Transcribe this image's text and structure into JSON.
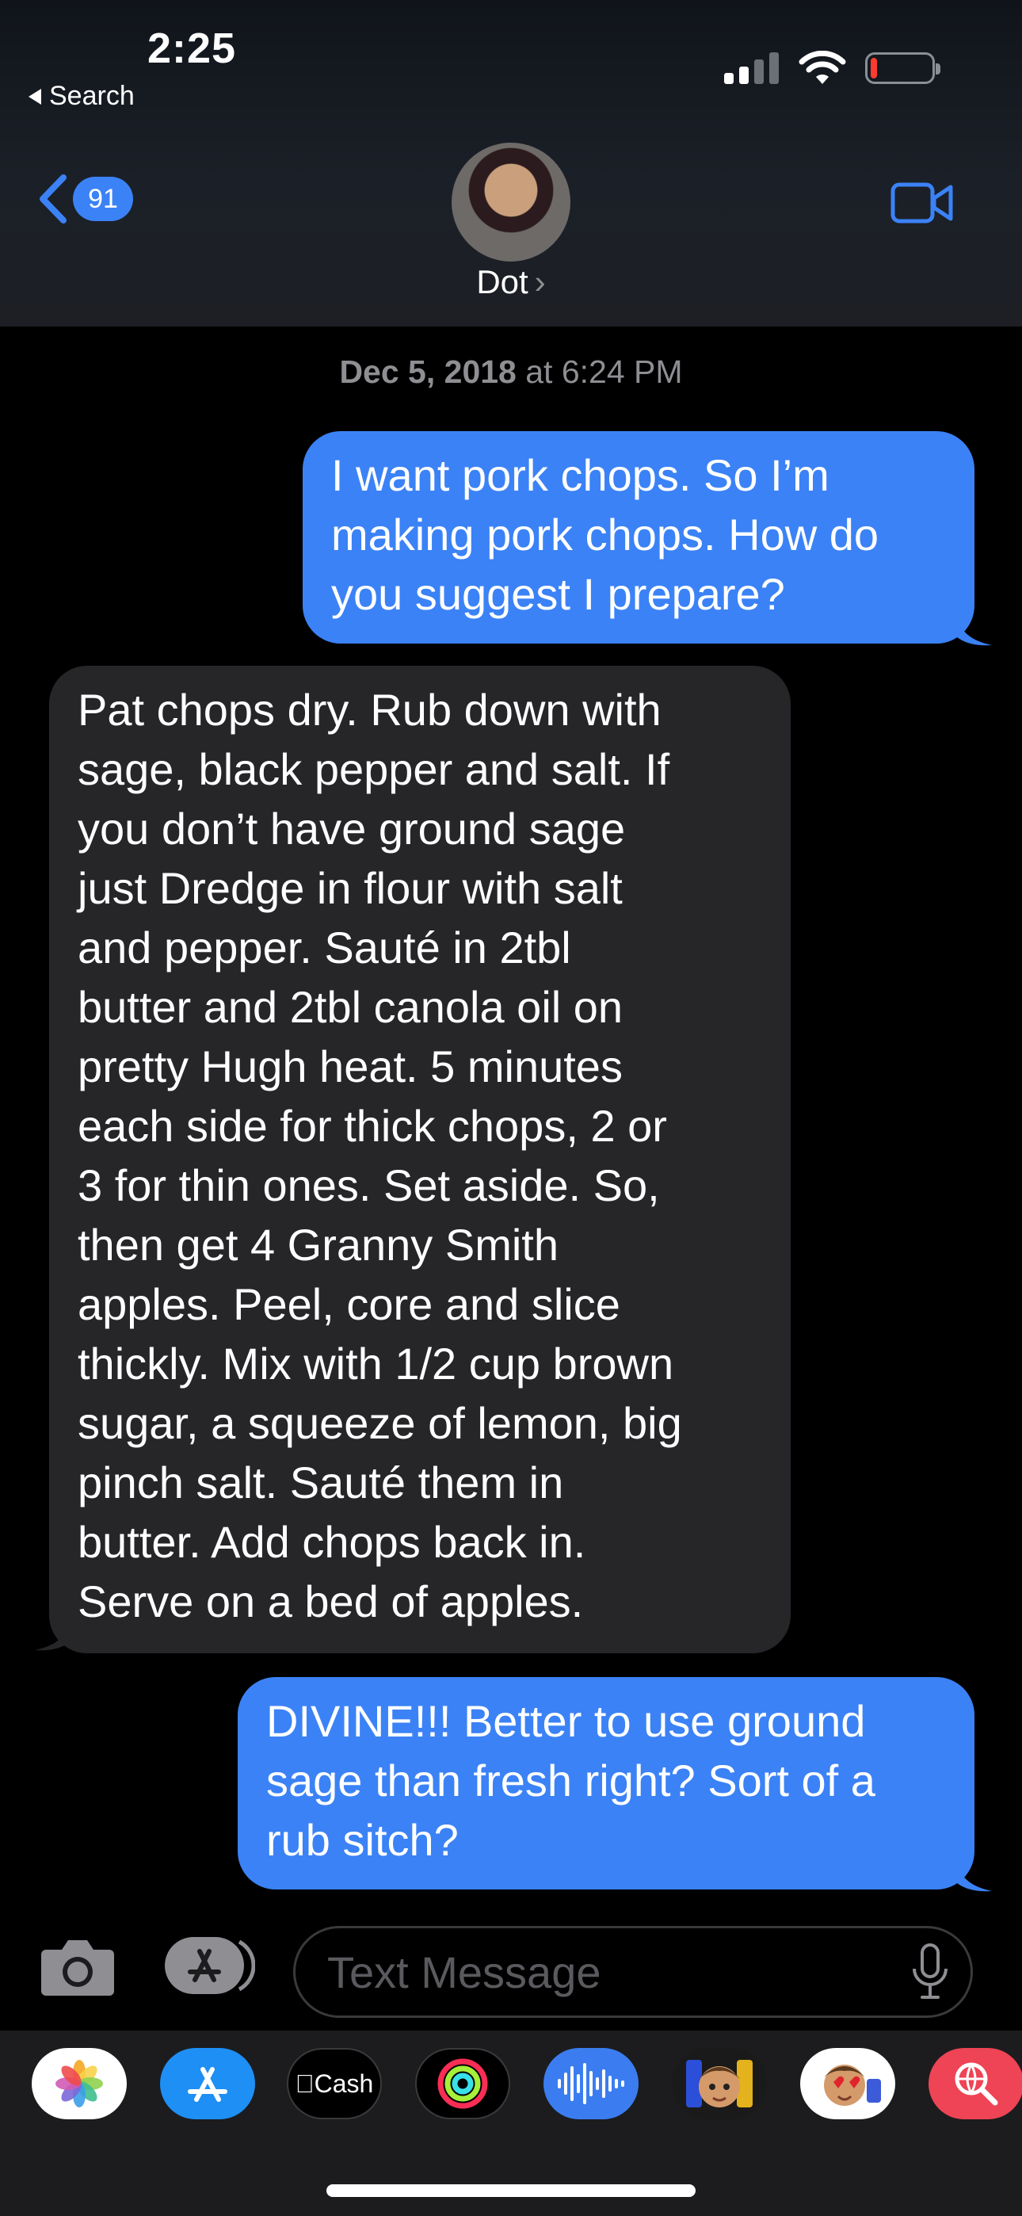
{
  "status": {
    "time": "2:25",
    "back_label": "Search"
  },
  "nav": {
    "unread_count": "91",
    "contact_name": "Dot",
    "contact_chevron": "›"
  },
  "conversation": {
    "timestamp_date": "Dec 5, 2018",
    "timestamp_time": " at 6:24 PM",
    "messages": [
      {
        "direction": "outgoing",
        "text": "I want pork chops. So I’m\nmaking pork chops. How do\nyou suggest I prepare?"
      },
      {
        "direction": "incoming",
        "text": "Pat chops dry.  Rub down with\nsage, black pepper and salt.  If\nyou don’t have ground sage\njust Dredge in flour with salt\nand pepper.   Sauté in 2tbl\nbutter and 2tbl canola oil on\npretty Hugh heat.  5 minutes\neach side for thick chops, 2 or\n3 for thin ones.  Set aside.  So,\nthen get 4 Granny Smith\napples.  Peel, core and slice\nthickly.   Mix with 1/2 cup brown\nsugar, a squeeze of lemon, big\npinch salt.  Sauté them in\nbutter.  Add chops back in.\nServe on a bed of apples."
      },
      {
        "direction": "outgoing",
        "text": "DIVINE!!! Better to use ground\nsage than fresh right? Sort of a\nrub sitch?"
      }
    ]
  },
  "composer": {
    "placeholder": "Text Message"
  },
  "app_drawer": {
    "apps": [
      {
        "name": "photos-app-icon"
      },
      {
        "name": "app-store-icon"
      },
      {
        "name": "apple-cash-icon",
        "label": "Cash"
      },
      {
        "name": "activity-icon"
      },
      {
        "name": "audio-message-icon"
      },
      {
        "name": "memoji-icon"
      },
      {
        "name": "memoji-stickers-icon"
      },
      {
        "name": "search-images-icon"
      }
    ]
  },
  "colors": {
    "outgoing_bubble": "#3b82f6",
    "incoming_bubble": "#262629",
    "accent": "#3b82f6"
  }
}
